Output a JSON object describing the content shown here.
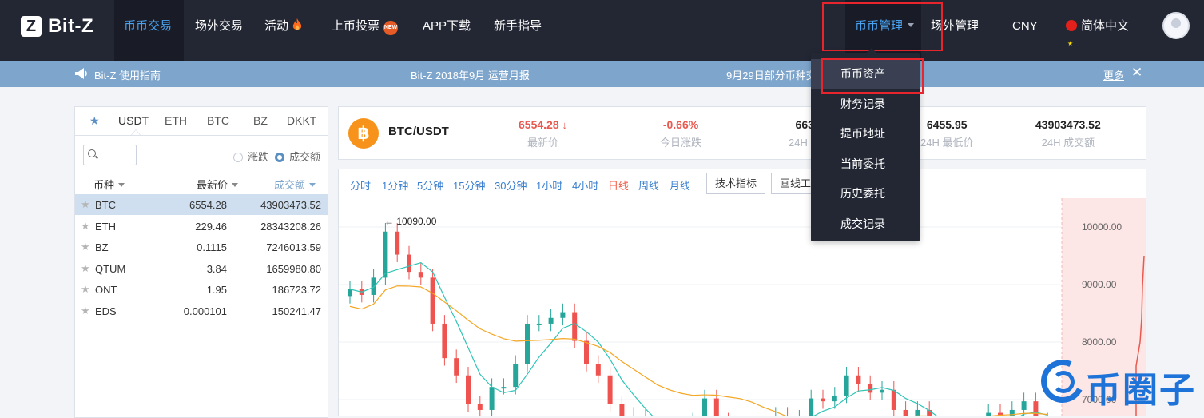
{
  "brand": {
    "logo_text": "Bit-Z",
    "logo_mark": "Z"
  },
  "nav": {
    "items": [
      "币币交易",
      "场外交易",
      "活动",
      "上币投票",
      "APP下载",
      "新手指导"
    ],
    "new_badge": "NEW",
    "right": {
      "coin_mgmt": "币币管理",
      "otc_mgmt": "场外管理",
      "currency": "CNY",
      "language": "简体中文"
    }
  },
  "dropdown": {
    "items": [
      "币币资产",
      "财务记录",
      "提币地址",
      "当前委托",
      "历史委托",
      "成交记录"
    ]
  },
  "notice": {
    "guide": "Bit-Z 使用指南",
    "report": "Bit-Z 2018年9月 运营月报",
    "announce": "9月29日部分币种交",
    "more": "更多"
  },
  "market": {
    "tabs": [
      "USDT",
      "ETH",
      "BTC",
      "BZ",
      "DKKT"
    ],
    "radio": [
      "涨跌",
      "成交额"
    ],
    "columns": {
      "coin": "币种",
      "price": "最新价",
      "volume": "成交额"
    },
    "rows": [
      {
        "sym": "BTC",
        "price": "6554.28",
        "vol": "43903473.52"
      },
      {
        "sym": "ETH",
        "price": "229.46",
        "vol": "28343208.26"
      },
      {
        "sym": "BZ",
        "price": "0.1115",
        "vol": "7246013.59"
      },
      {
        "sym": "QTUM",
        "price": "3.84",
        "vol": "1659980.80"
      },
      {
        "sym": "ONT",
        "price": "1.95",
        "vol": "186723.72"
      },
      {
        "sym": "EDS",
        "price": "0.000101",
        "vol": "150241.47"
      }
    ]
  },
  "ticker": {
    "pair": "BTC/USDT",
    "logo": "฿",
    "last": "6554.28",
    "last_label": "最新价",
    "change": "-0.66%",
    "change_label": "今日涨跌",
    "high": "663",
    "high_label": "24H 最",
    "low": "6455.95",
    "low_label": "24H 最低价",
    "volume": "43903473.52",
    "volume_label": "24H 成交额"
  },
  "chart": {
    "intervals": [
      "分时",
      "1分钟",
      "5分钟",
      "15分钟",
      "30分钟",
      "1小时",
      "4小时",
      "日线",
      "周线",
      "月线"
    ],
    "selected_interval": "日线",
    "btn_indicators": "技术指标",
    "btn_drawing": "画线工",
    "max_label": "← 10090.00",
    "y_labels": [
      "10000.00",
      "9000.00",
      "8000.00",
      "7000.00"
    ]
  },
  "watermark": {
    "text": "币圈子"
  },
  "colors": {
    "nav_bg": "#232734",
    "accent": "#4aa3f0",
    "up": "#26a69a",
    "down": "#ef5350",
    "notice_bg": "#7ea5cc"
  }
}
